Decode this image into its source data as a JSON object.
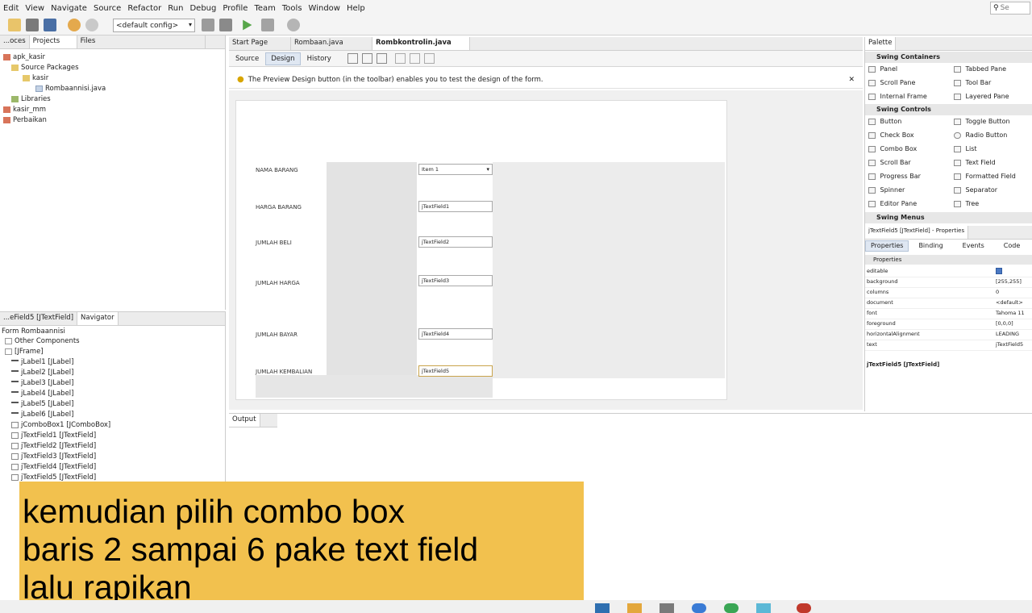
{
  "menu": [
    "Edit",
    "View",
    "Navigate",
    "Source",
    "Refactor",
    "Run",
    "Debug",
    "Profile",
    "Team",
    "Tools",
    "Window",
    "Help"
  ],
  "search": {
    "placeholder": "Se"
  },
  "toolbar": {
    "config": "<default config>"
  },
  "projects": {
    "tabs": [
      "...oces",
      "Projects",
      "Files"
    ],
    "tree": [
      "apk_kasir",
      "Source Packages",
      "kasir",
      "Rombaannisi.java",
      "Libraries",
      "kasir_mm",
      "Perbaikan"
    ]
  },
  "navigator": {
    "tabs": [
      "...eField5 [JTextField]",
      "Navigator"
    ],
    "tree": [
      "Form Rombaannisi",
      "Other Components",
      "[JFrame]",
      "jLabel1 [JLabel]",
      "jLabel2 [JLabel]",
      "jLabel3 [JLabel]",
      "jLabel4 [JLabel]",
      "jLabel5 [JLabel]",
      "jLabel6 [JLabel]",
      "jComboBox1 [JComboBox]",
      "jTextField1 [JTextField]",
      "jTextField2 [JTextField]",
      "jTextField3 [JTextField]",
      "jTextField4 [JTextField]",
      "jTextField5 [JTextField]"
    ]
  },
  "editor": {
    "tabs": [
      "Start Page",
      "Rombaan.java",
      "Rombkontrolin.java"
    ],
    "subtabs": [
      "Source",
      "Design",
      "History"
    ],
    "hint": "The Preview Design button (in the toolbar) enables you to test the design of the form."
  },
  "form": {
    "labels": [
      "NAMA BARANG",
      "HARGA BARANG",
      "JUMLAH BELI",
      "JUMLAH HARGA",
      "JUMLAH BAYAR",
      "JUMLAH KEMBALIAN"
    ],
    "combo_value": "Item 1",
    "fields": [
      "jTextField1",
      "jTextField2",
      "jTextField3",
      "jTextField4",
      "jTextField5"
    ]
  },
  "output": {
    "tab": "Output"
  },
  "palette": {
    "tab": "Palette",
    "containers_header": "Swing Containers",
    "containers": [
      "Panel",
      "Tabbed Pane",
      "Scroll Pane",
      "Tool Bar",
      "Internal Frame",
      "Layered Pane"
    ],
    "controls_header": "Swing Controls",
    "controls": [
      "Button",
      "Toggle Button",
      "Check Box",
      "Radio Button",
      "Combo Box",
      "List",
      "Scroll Bar",
      "Text Field",
      "Progress Bar",
      "Formatted Field",
      "Spinner",
      "Separator",
      "Editor Pane",
      "Tree"
    ],
    "menus_header": "Swing Menus"
  },
  "properties": {
    "title": "jTextField5 [JTextField] - Properties",
    "tabs": [
      "Properties",
      "Binding",
      "Events",
      "Code"
    ],
    "section": "Properties",
    "rows": [
      {
        "name": "editable",
        "value": ""
      },
      {
        "name": "background",
        "value": "[255,255]"
      },
      {
        "name": "columns",
        "value": "0"
      },
      {
        "name": "document",
        "value": "<default>"
      },
      {
        "name": "font",
        "value": "Tahoma 11"
      },
      {
        "name": "foreground",
        "value": "[0,0,0]"
      },
      {
        "name": "horizontalAlignment",
        "value": "LEADING"
      },
      {
        "name": "text",
        "value": "jTextField5"
      }
    ],
    "footer": "jTextField5 [JTextField]"
  },
  "caption": {
    "lines": [
      "kemudian pilih combo box",
      "baris 2 sampai 6 pake text field",
      "lalu rapikan"
    ],
    "bg": "#f2c14e"
  }
}
